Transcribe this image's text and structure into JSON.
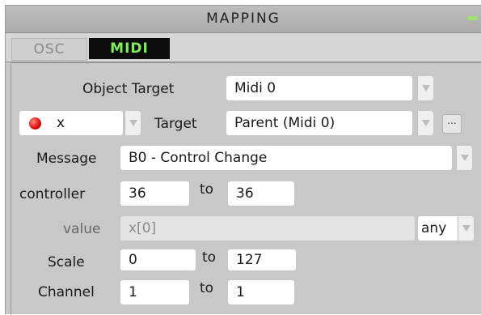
{
  "panel": {
    "title": "MAPPING",
    "tabs": [
      "OSC",
      "MIDI"
    ],
    "active_tab": "MIDI",
    "accent_color": "#7cf05a"
  },
  "form": {
    "object_target_label": "Object Target",
    "object_target_value": "Midi 0",
    "input_name": "x",
    "input_status_color": "#d11111",
    "target_label": "Target",
    "target_value": "Parent (Midi 0)",
    "more_button_label": "...",
    "message_label": "Message",
    "message_value": "B0 - Control Change",
    "controller_label": "controller",
    "controller_from": "36",
    "to_label": "to",
    "controller_to": "36",
    "value_label": "value",
    "value_expression": "x[0]",
    "value_mode": "any",
    "scale_label": "Scale",
    "scale_from": "0",
    "scale_to": "127",
    "channel_label": "Channel",
    "channel_from": "1",
    "channel_to": "1"
  }
}
